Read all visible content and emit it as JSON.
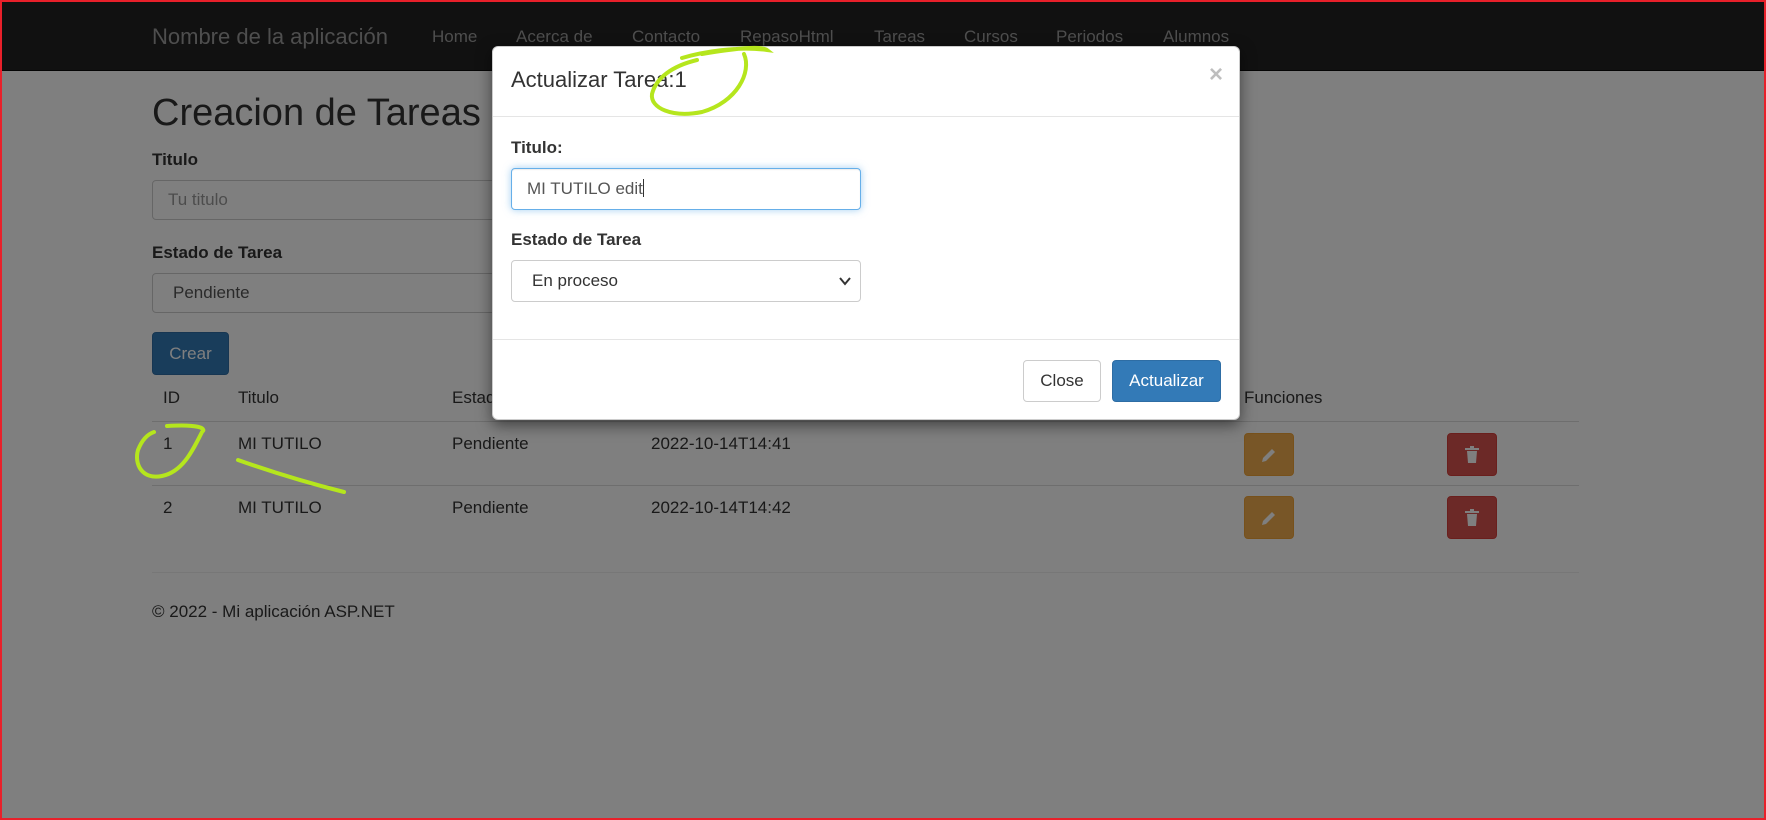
{
  "navbar": {
    "brand": "Nombre de la aplicación",
    "links": [
      "Home",
      "Acerca de",
      "Contacto",
      "RepasoHtml",
      "Tareas",
      "Cursos",
      "Periodos",
      "Alumnos"
    ]
  },
  "page": {
    "title": "Creacion de Tareas",
    "titulo_label": "Titulo",
    "titulo_placeholder": "Tu titulo",
    "estado_label": "Estado de Tarea",
    "estado_value": "Pendiente",
    "crear_label": "Crear"
  },
  "table": {
    "headers": [
      "ID",
      "Titulo",
      "Estado",
      "Funciones"
    ],
    "rows": [
      {
        "id": "1",
        "titulo": "MI TUTILO",
        "estado": "Pendiente",
        "fecha": "2022-10-14T14:41"
      },
      {
        "id": "2",
        "titulo": "MI TUTILO",
        "estado": "Pendiente",
        "fecha": "2022-10-14T14:42"
      }
    ]
  },
  "footer": {
    "text": "© 2022 - Mi aplicación ASP.NET"
  },
  "modal": {
    "title": "Actualizar Tarea:1",
    "close_glyph": "×",
    "titulo_label": "Titulo:",
    "titulo_value": "MI TUTILO edit",
    "estado_label": "Estado de Tarea",
    "estado_value": "En proceso",
    "close_label": "Close",
    "update_label": "Actualizar"
  },
  "colors": {
    "primary": "#337ab7",
    "warning": "#f0ad4e",
    "danger": "#d9534f",
    "annotation": "#b5e61d",
    "frame": "#e8202a"
  },
  "icons": {
    "edit": "pencil-icon",
    "delete": "trash-icon"
  }
}
